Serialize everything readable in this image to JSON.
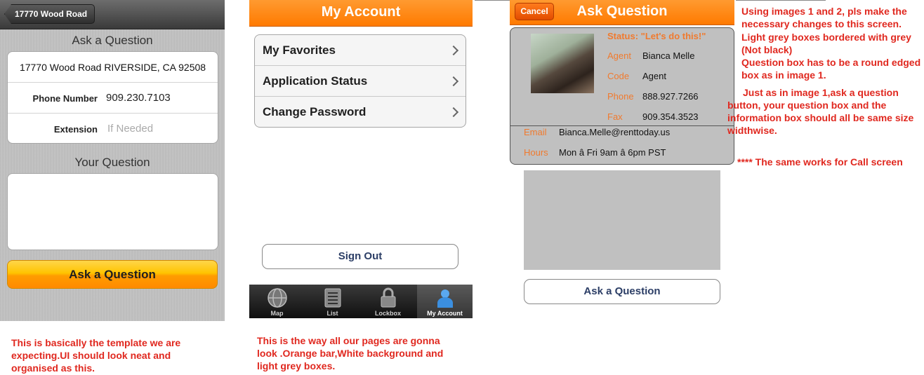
{
  "screen1": {
    "back_label": "17770 Wood Road",
    "ask_heading": "Ask a Question",
    "address": "17770 Wood Road RIVERSIDE, CA 92508",
    "phone_label": "Phone Number",
    "phone_value": "909.230.7103",
    "extension_label": "Extension",
    "extension_placeholder": "If Needed",
    "your_question_heading": "Your Question",
    "ask_button": "Ask a Question",
    "caption": "This is basically the template we are expecting.UI should look neat and organised as this."
  },
  "screen2": {
    "title": "My Account",
    "menu": [
      {
        "label": "My Favorites"
      },
      {
        "label": "Application Status"
      },
      {
        "label": "Change Password"
      }
    ],
    "sign_out": "Sign Out",
    "tabs": [
      {
        "label": "Map",
        "icon": "globe-icon"
      },
      {
        "label": "List",
        "icon": "list-icon"
      },
      {
        "label": "Lockbox",
        "icon": "lock-icon"
      },
      {
        "label": "My Account",
        "icon": "person-icon",
        "active": true
      }
    ],
    "caption": "This is the way all our pages are gonna look .Orange bar,White background and light grey boxes."
  },
  "screen3": {
    "cancel": "Cancel",
    "title": "Ask Question",
    "status": "Status: \"Let's do this!\"",
    "agent_label": "Agent",
    "agent_value": "Bianca Melle",
    "code_label": "Code",
    "code_value": "Agent",
    "phone_label": "Phone",
    "phone_value": "888.927.7266",
    "fax_label": "Fax",
    "fax_value": "909.354.3523",
    "email_label": "Email",
    "email_value": "Bianca.Melle@renttoday.us",
    "hours_label": "Hours",
    "hours_value": "Mon â Fri 9am â 6pm PST",
    "ask_button": "Ask a Question"
  },
  "notes": {
    "note1": "Using images 1 and 2, pls make the necessary changes to this screen.",
    "note2": "Light grey boxes bordered with grey (Not black)",
    "note3": "Question box has to be a round edged box as in image 1.",
    "note4": "Just as in image 1,ask a question button, your question box and the information box should all be same size widthwise.",
    "note5": "**** The same works for Call screen"
  },
  "colors": {
    "orange_bar": "#ff8000",
    "annotation_red": "#e0281f",
    "light_grey_box": "#c0c0c0"
  }
}
